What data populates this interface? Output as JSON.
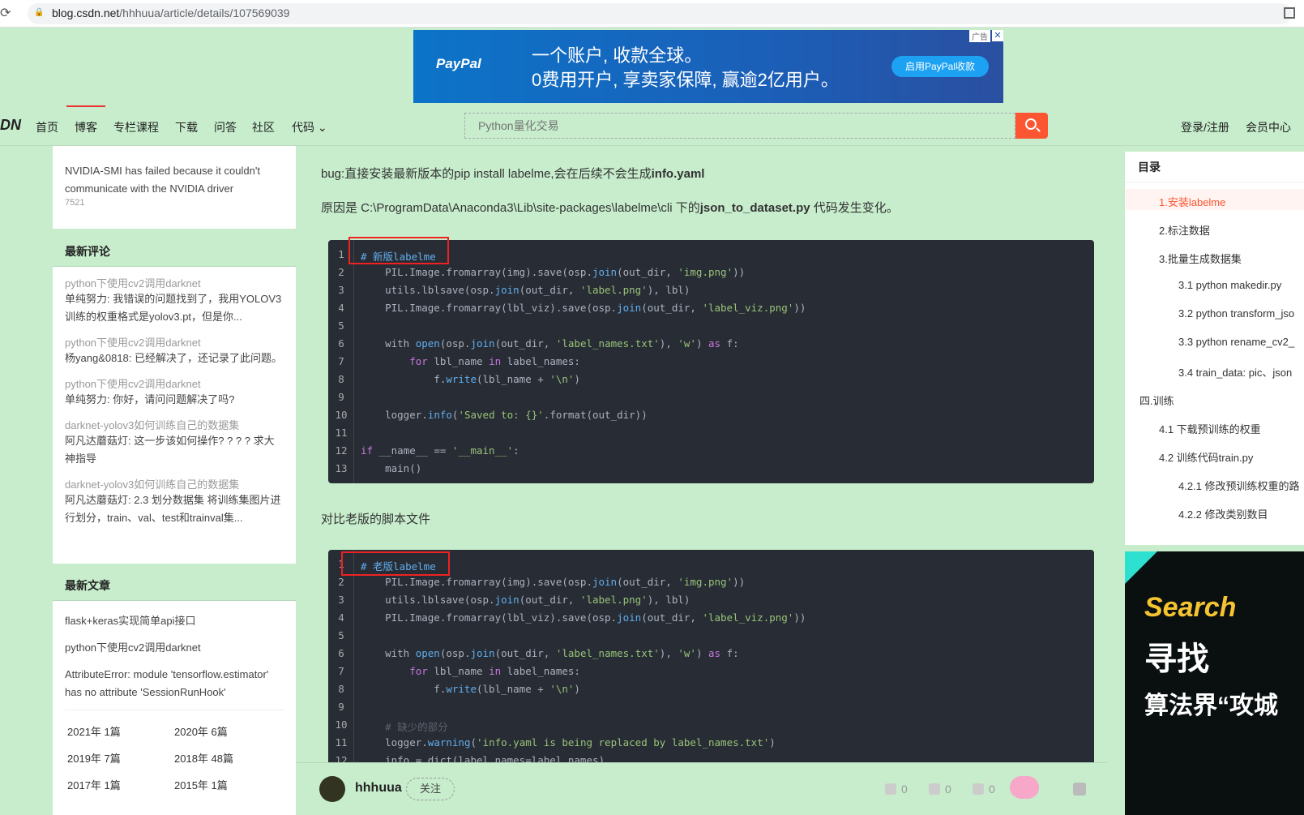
{
  "browser": {
    "url_host": "blog.csdn.net",
    "url_path": "/hhhuua/article/details/107569039"
  },
  "ad": {
    "brand": "PayPal",
    "line1": "一个账户, 收款全球。",
    "line2": "0费用开户, 享卖家保障, 赢逾2亿用户。",
    "cta": "启用PayPal收款",
    "tag": "广告",
    "close": "✕"
  },
  "nav": {
    "brand": "DN",
    "items": [
      "首页",
      "博客",
      "专栏课程",
      "下载",
      "问答",
      "社区",
      "代码 ⌄"
    ],
    "search_placeholder": "Python量化交易",
    "login": "登录/注册",
    "member": "会员中心"
  },
  "left": {
    "top_item": {
      "title": "NVIDIA-SMI has failed because it couldn't communicate with the NVIDIA driver",
      "views": "7521"
    },
    "comments_title": "最新评论",
    "comments": [
      {
        "t": "python下使用cv2调用darknet",
        "c": "单纯努力: 我错误的问题找到了，我用YOLOV3训练的权重格式是yolov3.pt，但是你..."
      },
      {
        "t": "python下使用cv2调用darknet",
        "c": "杨yang&0818: 已经解决了，还记录了此问题。"
      },
      {
        "t": "python下使用cv2调用darknet",
        "c": "单纯努力: 你好，请问问题解决了吗?"
      },
      {
        "t": "darknet-yolov3如何训练自己的数据集",
        "c": "阿凡达蘑菇灯: 这一步该如何操作? ? ? ? 求大神指导"
      },
      {
        "t": "darknet-yolov3如何训练自己的数据集",
        "c": "阿凡达蘑菇灯: 2.3 划分数据集 将训练集图片进行划分，train、val、test和trainval集..."
      }
    ],
    "articles_title": "最新文章",
    "articles": [
      "flask+keras实现简单api接口",
      "python下使用cv2调用darknet",
      "AttributeError: module 'tensorflow.estimator' has no attribute 'SessionRunHook'"
    ],
    "archive": [
      "2021年  1篇",
      "2020年  6篇",
      "2019年  7篇",
      "2018年  48篇",
      "2017年  1篇",
      "2015年  1篇"
    ]
  },
  "main": {
    "p1_a": "bug:直接安装最新版本的pip install labelme,会在后续不会生成",
    "p1_b": "info.yaml",
    "p2_a": "原因是 C:\\ProgramData\\Anaconda3\\Lib\\site-packages\\labelme\\cli 下的",
    "p2_b": "json_to_dataset.py",
    "p2_c": " 代码发生变化。",
    "p3": "对比老版的脚本文件"
  },
  "toc": {
    "title": "目录",
    "items": [
      "1.安装labelme",
      "2.标注数据",
      "3.批量生成数据集",
      "3.1  python makedir.py",
      "3.2  python transform_jso",
      "3.3  python rename_cv2_",
      "3.4 train_data:  pic、json",
      "四.训练",
      "4.1 下载预训练的权重",
      "4.2 训练代码train.py",
      "4.2.1 修改预训练权重的路",
      "4.2.2 修改类别数目"
    ]
  },
  "side_ad": {
    "line1": "Search",
    "line2": "寻找",
    "line3": "算法界“攻城"
  },
  "footer": {
    "username": "hhhuua",
    "follow": "关注",
    "likes": "0",
    "comments": "0",
    "stars": "0"
  }
}
